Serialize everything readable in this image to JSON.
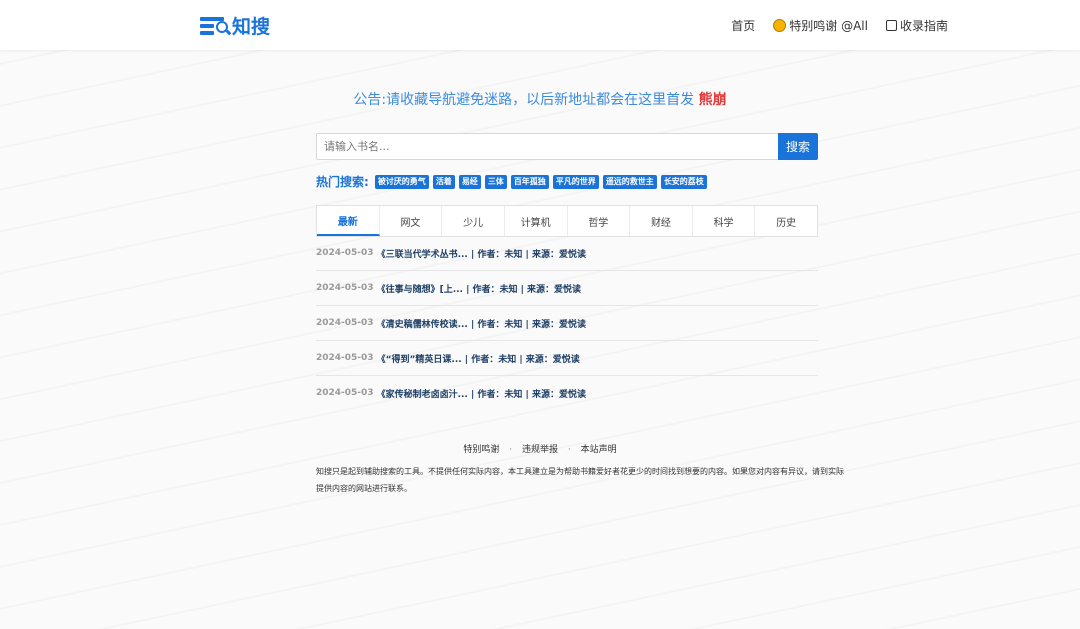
{
  "header": {
    "logo_text": "知搜",
    "nav": [
      {
        "label": "首页",
        "icon": ""
      },
      {
        "label": "特别鸣谢 @All",
        "icon": "smiley-icon"
      },
      {
        "label": "收录指南",
        "icon": "print-icon"
      }
    ]
  },
  "notice": {
    "text": "公告:请收藏导航避免迷路，以后新地址都会在这里首发",
    "highlight": "熊崩"
  },
  "search": {
    "placeholder": "请输入书名...",
    "button_label": "搜索"
  },
  "hot": {
    "label": "热门搜索:",
    "tags": [
      "被讨厌的勇气",
      "活着",
      "易经",
      "三体",
      "百年孤独",
      "平凡的世界",
      "遥远的救世主",
      "长安的荔枝"
    ]
  },
  "tabs": [
    "最新",
    "网文",
    "少儿",
    "计算机",
    "哲学",
    "财经",
    "科学",
    "历史"
  ],
  "active_tab": "最新",
  "list": [
    {
      "date": "2024-05-03",
      "title": "《三联当代学术丛书... | 作者：未知 | 来源：爱悦读"
    },
    {
      "date": "2024-05-03",
      "title": "《往事与随想》[上... | 作者：未知 | 来源：爱悦读"
    },
    {
      "date": "2024-05-03",
      "title": "《清史稿儒林传校读... | 作者：未知 | 来源：爱悦读"
    },
    {
      "date": "2024-05-03",
      "title": "《“得到”精英日课... | 作者：未知 | 来源：爱悦读"
    },
    {
      "date": "2024-05-03",
      "title": "《家传秘制老卤卤汁... | 作者：未知 | 来源：爱悦读"
    }
  ],
  "footer": {
    "links": [
      "特别鸣谢",
      "违规举报",
      "本站声明"
    ],
    "separator": "·",
    "text": "知搜只是起到辅助搜索的工具。不提供任何实际内容，本工具建立是为帮助书籍爱好者花更少的时间找到想要的内容。如果您对内容有异议，请到实际提供内容的网站进行联系。"
  },
  "colors": {
    "accent": "#1a73d9",
    "notice": "#3d8bdc",
    "highlight": "#e03a3a"
  }
}
